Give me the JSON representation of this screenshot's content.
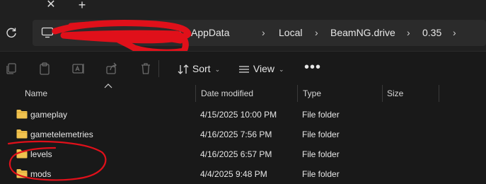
{
  "tabstrip": {
    "close_icon": "close-icon",
    "new_tab_icon": "plus-icon"
  },
  "navbar": {
    "refresh_icon": "refresh-icon",
    "location_icon": "this-pc-icon",
    "breadcrumbs": [
      "AppData",
      "Local",
      "BeamNG.drive",
      "0.35"
    ],
    "separator_icon": "chevron-right-icon",
    "redaction_color": "#e0101a"
  },
  "commandbar": {
    "icons": [
      "copy-icon",
      "paste-icon",
      "rename-icon",
      "share-icon",
      "delete-icon"
    ],
    "sort_label": "Sort",
    "view_label": "View",
    "more_label": "•••"
  },
  "columns": {
    "name": "Name",
    "date_modified": "Date modified",
    "type": "Type",
    "size": "Size"
  },
  "files": [
    {
      "name": "gameplay",
      "date": "4/15/2025 10:00 PM",
      "type": "File folder",
      "size": ""
    },
    {
      "name": "gametelemetries",
      "date": "4/16/2025 7:56 PM",
      "type": "File folder",
      "size": ""
    },
    {
      "name": "levels",
      "date": "4/16/2025 6:57 PM",
      "type": "File folder",
      "size": ""
    },
    {
      "name": "mods",
      "date": "4/4/2025 9:48 PM",
      "type": "File folder",
      "size": ""
    }
  ],
  "colors": {
    "background": "#191919",
    "folder": "#f0c24f",
    "annotation": "#e0101a"
  }
}
